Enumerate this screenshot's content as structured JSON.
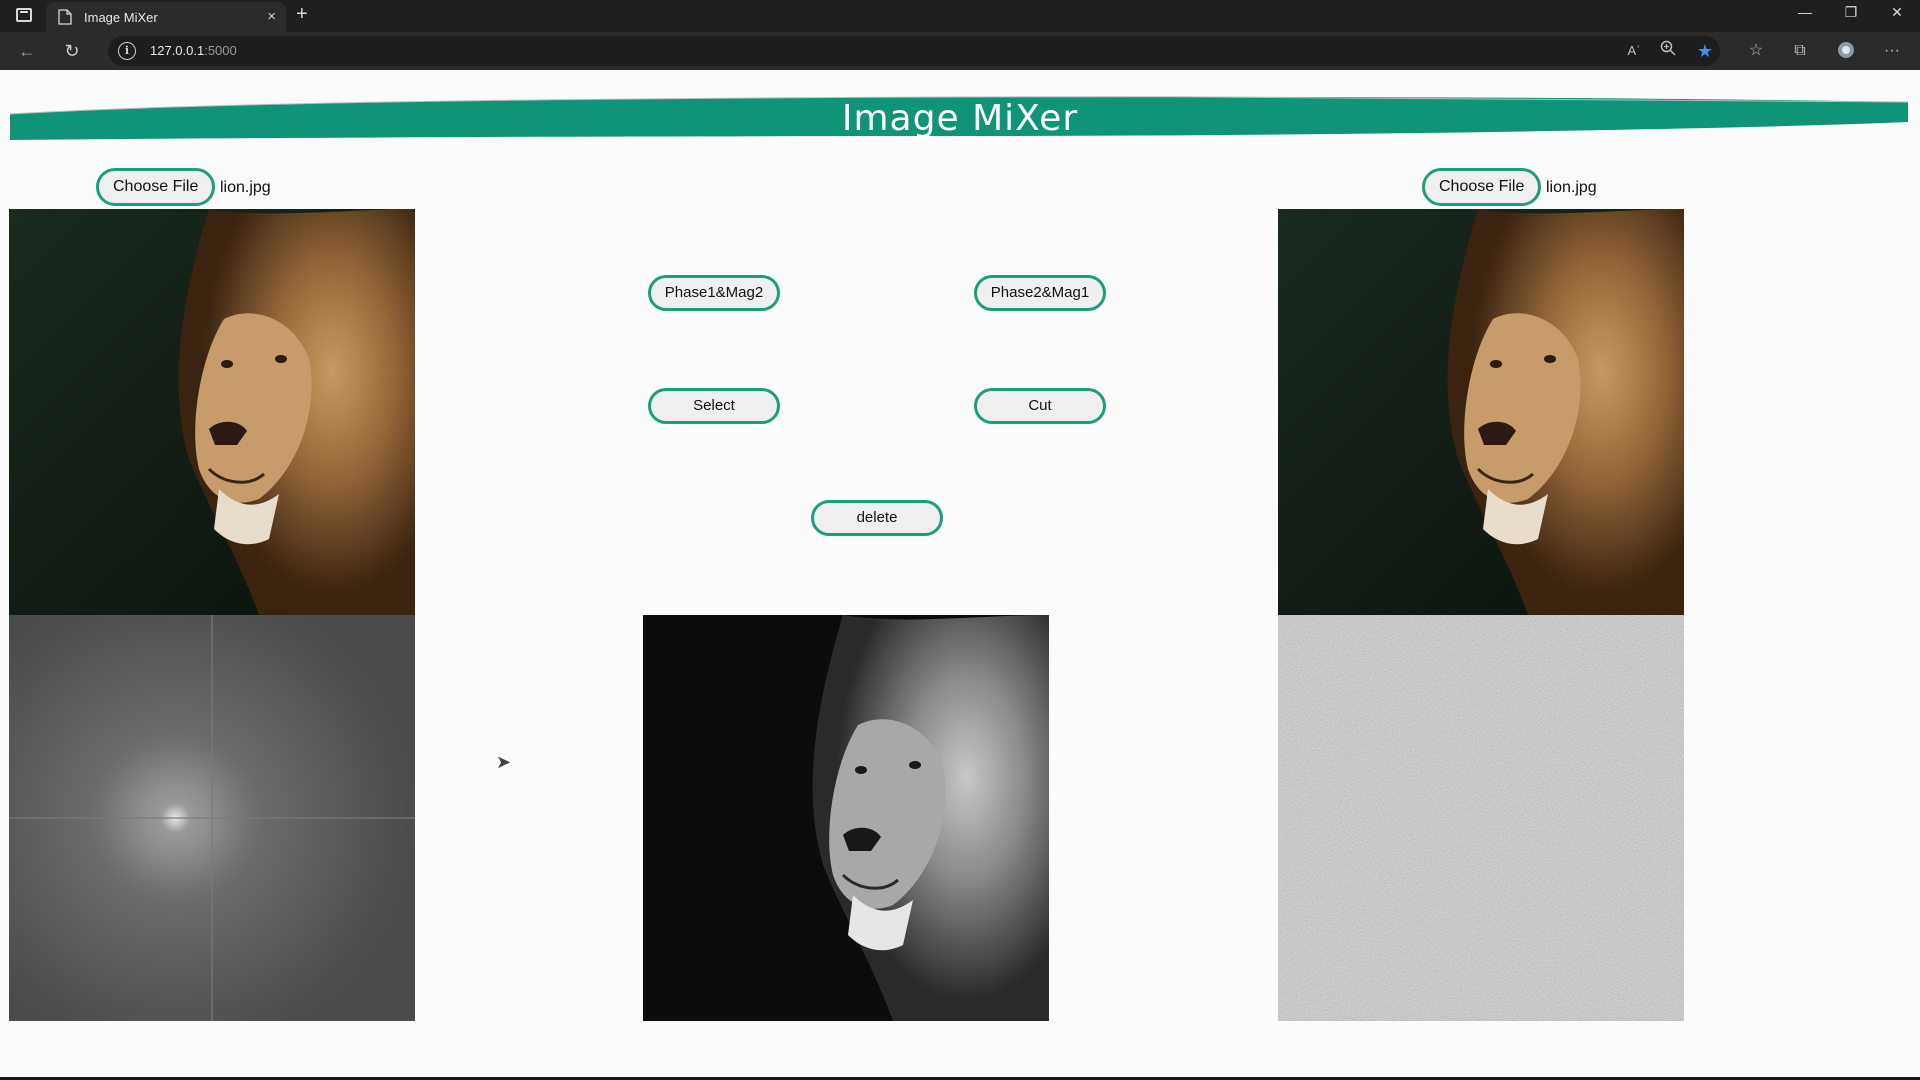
{
  "browser": {
    "tab_title": "Image MiXer",
    "tab_close": "×",
    "new_tab": "+",
    "url_host": "127.0.0.1",
    "url_port": ":5000",
    "minimize": "—",
    "restore": "❐",
    "close": "✕",
    "more": "···",
    "read_aloud": "Aʾ"
  },
  "page": {
    "title": "Image MiXer"
  },
  "left_panel": {
    "choose_file_label": "Choose File",
    "file_name": "lion.jpg"
  },
  "right_panel": {
    "choose_file_label": "Choose File",
    "file_name": "lion.jpg"
  },
  "controls": {
    "phase1_mag2": "Phase1&Mag2",
    "phase2_mag1": "Phase2&Mag1",
    "select": "Select",
    "cut": "Cut",
    "delete": "delete"
  },
  "colors": {
    "accent": "#1a9e7e",
    "banner": "#0f9478",
    "page_bg": "#fbfbfb",
    "chrome_dark": "#1f1f1f",
    "favorite_star": "#3b8eea"
  }
}
